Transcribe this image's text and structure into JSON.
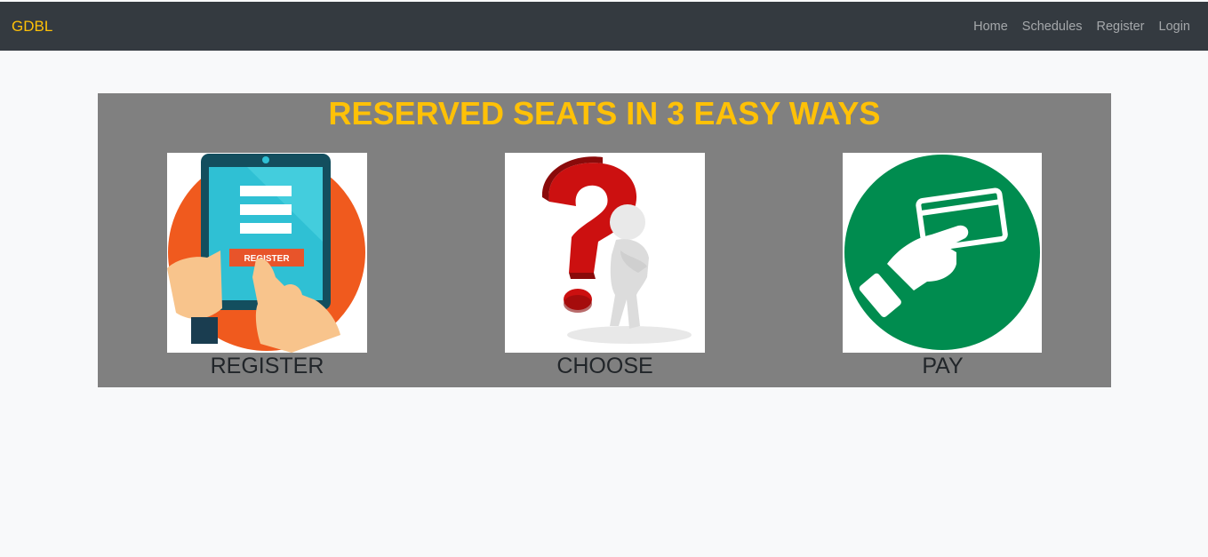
{
  "navbar": {
    "brand": "GDBL",
    "links": [
      {
        "label": "Home"
      },
      {
        "label": "Schedules"
      },
      {
        "label": "Register"
      },
      {
        "label": "Login"
      }
    ]
  },
  "hero": {
    "title": "RESERVED SEATS IN 3 EASY WAYS",
    "steps": [
      {
        "label": "REGISTER",
        "icon": "tablet-register-icon",
        "button_text": "REGISTER"
      },
      {
        "label": "CHOOSE",
        "icon": "question-person-icon"
      },
      {
        "label": "PAY",
        "icon": "card-payment-icon"
      }
    ]
  },
  "colors": {
    "navbar_bg": "#343a40",
    "brand": "#ffc107",
    "panel_bg": "#808080",
    "page_bg": "#f8f9fa"
  }
}
